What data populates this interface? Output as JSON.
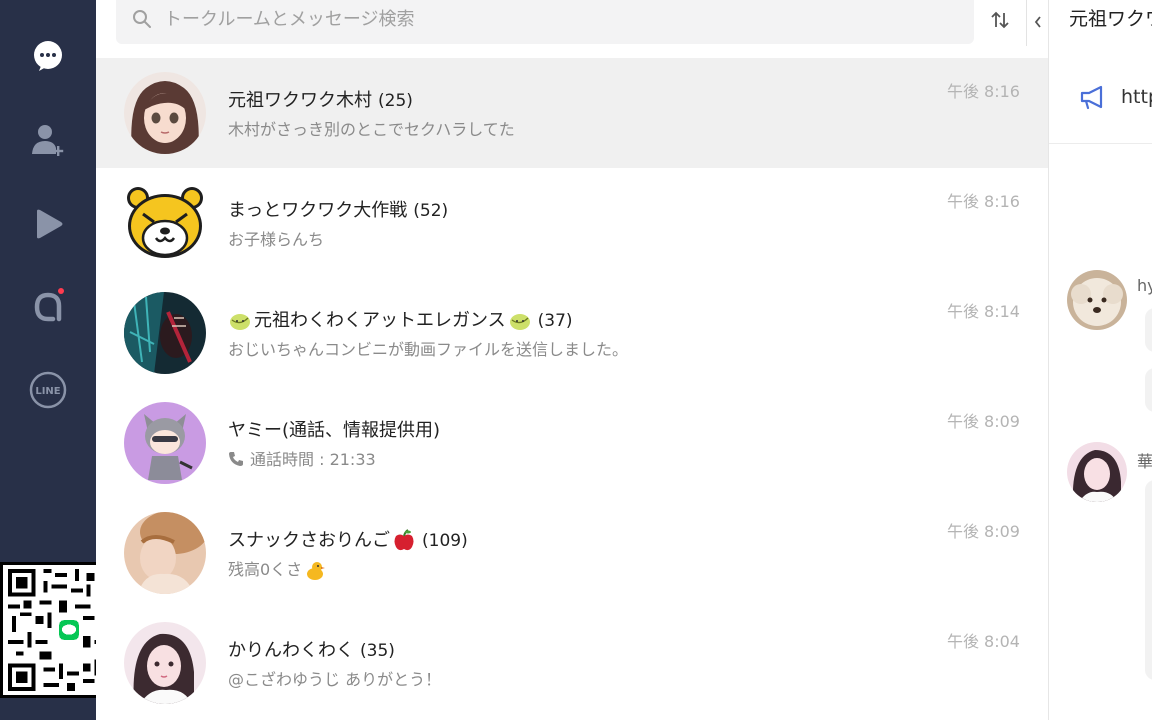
{
  "search": {
    "placeholder": "トークルームとメッセージ検索"
  },
  "rail": {
    "items": [
      {
        "icon": "chat-bubble-icon"
      },
      {
        "icon": "add-friend-icon"
      },
      {
        "icon": "voom-play-icon"
      },
      {
        "icon": "openchat-a-icon",
        "badge": true
      },
      {
        "icon": "line-logo-icon"
      }
    ]
  },
  "chats": [
    {
      "name": "元祖ワクワク木村",
      "count": "(25)",
      "message": "木村がさっき別のとこでセクハラしてた",
      "time": "午後 8:16",
      "selected": true
    },
    {
      "name": "まっとワクワク大作戦",
      "count": "(52)",
      "message": "お子様らんち",
      "time": "午後 8:16"
    },
    {
      "name": "元祖わくわくアットエレガンス",
      "count": "(37)",
      "message": "おじいちゃんコンビニが動画ファイルを送信しました。",
      "time": "午後 8:14"
    },
    {
      "name": "ヤミー(通話、情報提供用)",
      "count": "",
      "message": "通話時間 : 21:33",
      "time": "午後 8:09"
    },
    {
      "name": "スナックさおりんご",
      "count": "(109)",
      "message": "残高0くさ",
      "time": "午後 8:09"
    },
    {
      "name": "かりんわくわく",
      "count": "(35)",
      "message": "@こざわゆうじ ありがとう！",
      "time": "午後 8:04"
    }
  ],
  "chat_panel": {
    "title": "元祖ワクワ",
    "announcement": "http",
    "senders": [
      "hy",
      "華"
    ]
  },
  "colors": {
    "rail": "#283048",
    "selected_row": "#f0f0f0",
    "accent": "#4a6fd8"
  }
}
